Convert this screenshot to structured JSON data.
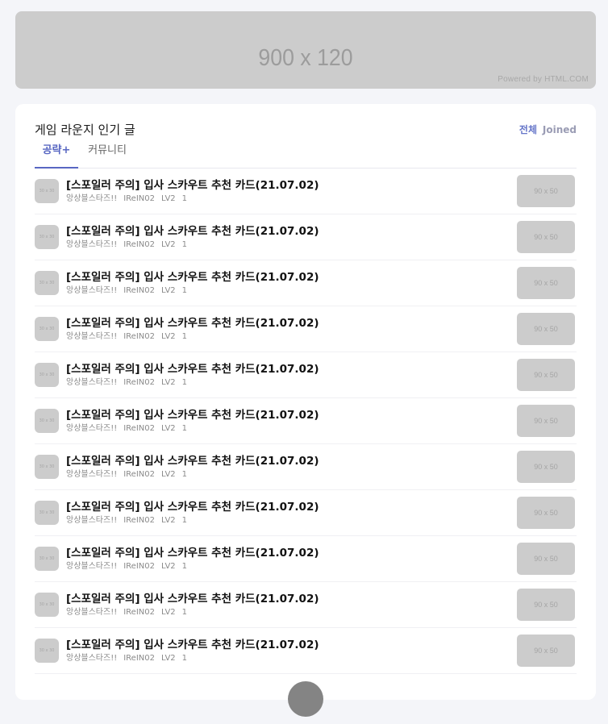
{
  "banner": {
    "label": "900 x 120",
    "credit": "Powered by HTML.COM"
  },
  "section": {
    "title": "게임 라운지 인기 글",
    "filters": {
      "all": "전체",
      "joined": "Joined"
    },
    "tabs": {
      "guide": "공략+",
      "community": "커뮤니티"
    }
  },
  "posts": [
    {
      "title": "[스포일러 주의] 입사 스카우트 추천 카드(21.07.02)",
      "game": "앙상블스타즈!!",
      "author": "IReIN02",
      "level": "LV2",
      "count": "1",
      "avatar_label": "30 x 30",
      "thumb_label": "90 x 50"
    },
    {
      "title": "[스포일러 주의] 입사 스카우트 추천 카드(21.07.02)",
      "game": "앙상블스타즈!!",
      "author": "IReIN02",
      "level": "LV2",
      "count": "1",
      "avatar_label": "30 x 30",
      "thumb_label": "90 x 50"
    },
    {
      "title": "[스포일러 주의] 입사 스카우트 추천 카드(21.07.02)",
      "game": "앙상블스타즈!!",
      "author": "IReIN02",
      "level": "LV2",
      "count": "1",
      "avatar_label": "30 x 30",
      "thumb_label": "90 x 50"
    },
    {
      "title": "[스포일러 주의] 입사 스카우트 추천 카드(21.07.02)",
      "game": "앙상블스타즈!!",
      "author": "IReIN02",
      "level": "LV2",
      "count": "1",
      "avatar_label": "30 x 30",
      "thumb_label": "90 x 50"
    },
    {
      "title": "[스포일러 주의] 입사 스카우트 추천 카드(21.07.02)",
      "game": "앙상블스타즈!!",
      "author": "IReIN02",
      "level": "LV2",
      "count": "1",
      "avatar_label": "30 x 30",
      "thumb_label": "90 x 50"
    },
    {
      "title": "[스포일러 주의] 입사 스카우트 추천 카드(21.07.02)",
      "game": "앙상블스타즈!!",
      "author": "IReIN02",
      "level": "LV2",
      "count": "1",
      "avatar_label": "30 x 30",
      "thumb_label": "90 x 50"
    },
    {
      "title": "[스포일러 주의] 입사 스카우트 추천 카드(21.07.02)",
      "game": "앙상블스타즈!!",
      "author": "IReIN02",
      "level": "LV2",
      "count": "1",
      "avatar_label": "30 x 30",
      "thumb_label": "90 x 50"
    },
    {
      "title": "[스포일러 주의] 입사 스카우트 추천 카드(21.07.02)",
      "game": "앙상블스타즈!!",
      "author": "IReIN02",
      "level": "LV2",
      "count": "1",
      "avatar_label": "30 x 30",
      "thumb_label": "90 x 50"
    },
    {
      "title": "[스포일러 주의] 입사 스카우트 추천 카드(21.07.02)",
      "game": "앙상블스타즈!!",
      "author": "IReIN02",
      "level": "LV2",
      "count": "1",
      "avatar_label": "30 x 30",
      "thumb_label": "90 x 50"
    },
    {
      "title": "[스포일러 주의] 입사 스카우트 추천 카드(21.07.02)",
      "game": "앙상블스타즈!!",
      "author": "IReIN02",
      "level": "LV2",
      "count": "1",
      "avatar_label": "30 x 30",
      "thumb_label": "90 x 50"
    },
    {
      "title": "[스포일러 주의] 입사 스카우트 추천 카드(21.07.02)",
      "game": "앙상블스타즈!!",
      "author": "IReIN02",
      "level": "LV2",
      "count": "1",
      "avatar_label": "30 x 30",
      "thumb_label": "90 x 50"
    }
  ]
}
